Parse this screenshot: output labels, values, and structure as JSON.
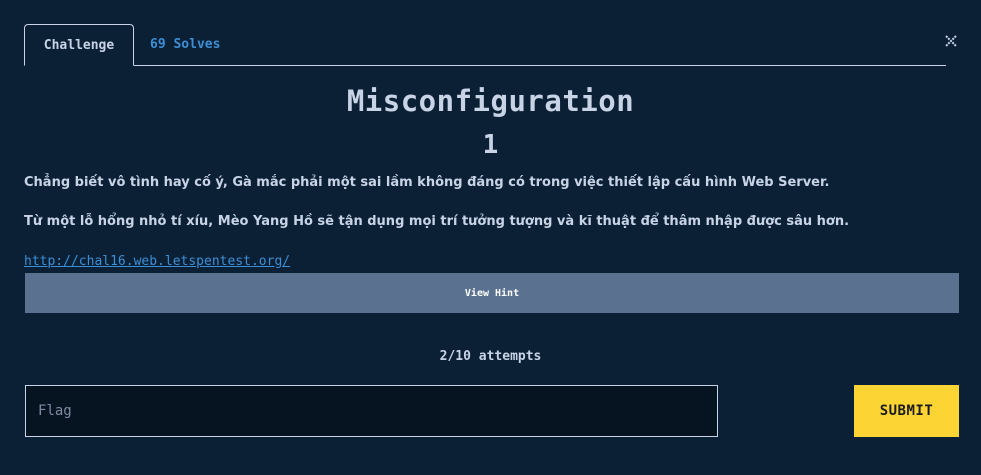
{
  "tabs": {
    "challenge_label": "Challenge",
    "solves_label": "69 Solves"
  },
  "challenge": {
    "name": "Misconfiguration",
    "value": "1",
    "description_line1": "Chẳng biết vô tình hay cố ý, Gà mắc phải một sai lầm không đáng có trong việc thiết lập cấu hình Web Server.",
    "description_line2": "Từ một lỗ hổng nhỏ tí xíu, Mèo Yang Hồ sẽ tận dụng mọi trí tưởng tượng và kĩ thuật để thâm nhập được sâu hơn.",
    "link": "http://chal16.web.letspentest.org/"
  },
  "hint": {
    "label": "View Hint"
  },
  "attempts": {
    "text": "2/10 attempts"
  },
  "flag": {
    "placeholder": "Flag",
    "value": ""
  },
  "submit": {
    "label": "SUBMIT"
  },
  "icons": {
    "close": "close-icon"
  },
  "colors": {
    "background": "#0b2035",
    "accent_link": "#3b8fd6",
    "hint_bar": "#5a7190",
    "submit": "#fcd535"
  }
}
